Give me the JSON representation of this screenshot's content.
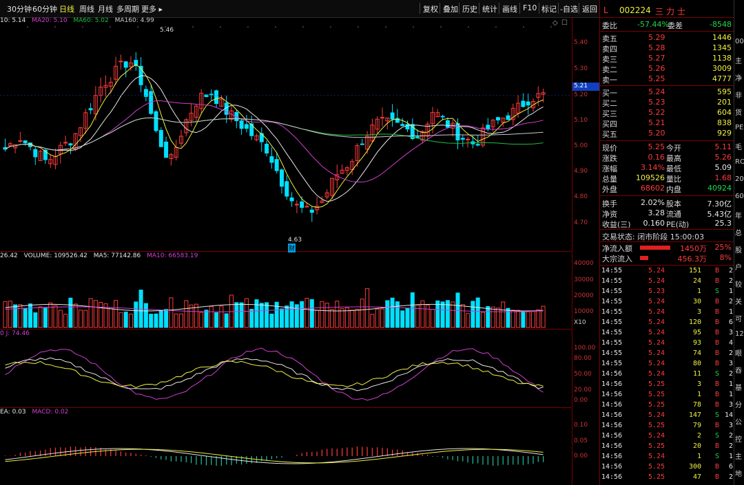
{
  "toolbar": {
    "periods": [
      "30分钟",
      "60分钟",
      "日线",
      "周线",
      "月线",
      "多周期",
      "更多 ▸"
    ],
    "active_period": "日线",
    "buttons": [
      "复权",
      "叠加",
      "历史",
      "统计",
      "画线",
      "F10",
      "标记",
      "-自选",
      "返回"
    ]
  },
  "main_chart": {
    "ma_legend": [
      {
        "text": "10: 5.14",
        "color": "#e8e8e8"
      },
      {
        "text": "MA20: 5.10",
        "color": "#d040d0"
      },
      {
        "text": "MA60: 5.02",
        "color": "#20c040"
      },
      {
        "text": "MA160: 4.99",
        "color": "#cccccc"
      }
    ],
    "high_label": "5.46",
    "low_label": "4.63",
    "low_marker": "财",
    "current_price_tag": "5.21",
    "ticks": [
      "5.40",
      "5.30",
      "5.20",
      "5.10",
      "5.00",
      "4.90",
      "4.80",
      "4.70"
    ]
  },
  "volume_chart": {
    "legend": [
      {
        "text": "26.42",
        "color": "#e8e8e8"
      },
      {
        "text": "VOLUME: 109526.42",
        "color": "#e8e8e8"
      },
      {
        "text": "MA5: 77142.86",
        "color": "#e8e8e8"
      },
      {
        "text": "MA10: 66583.19",
        "color": "#d040d0"
      }
    ],
    "ticks": [
      "40000",
      "30000",
      "20000",
      "10000"
    ],
    "unit": "X10"
  },
  "kdj_chart": {
    "legend": [
      {
        "text": "0  J: 74.46",
        "color": "#d040d0"
      }
    ],
    "ticks": [
      "100.00",
      "80.00",
      "50.00",
      "20.00",
      "0.00"
    ]
  },
  "macd_chart": {
    "legend": [
      {
        "text": "EA: 0.03",
        "color": "#e8e8e8"
      },
      {
        "text": "MACD: 0.02",
        "color": "#d040d0"
      }
    ],
    "ticks": [
      "0.10",
      "0.05",
      "0.00"
    ]
  },
  "quote": {
    "flag": "L",
    "code": "002224",
    "name": "三力士",
    "weibi_label": "委比",
    "weibi": "-57.44%",
    "weicha_label": "委差",
    "weicha": "-8548",
    "asks": [
      {
        "label": "卖五",
        "price": "5.29",
        "vol": "1446"
      },
      {
        "label": "卖四",
        "price": "5.28",
        "vol": "1345"
      },
      {
        "label": "卖三",
        "price": "5.27",
        "vol": "1138"
      },
      {
        "label": "卖二",
        "price": "5.26",
        "vol": "3009"
      },
      {
        "label": "卖一",
        "price": "5.25",
        "vol": "4777"
      }
    ],
    "bids": [
      {
        "label": "买一",
        "price": "5.24",
        "vol": "595"
      },
      {
        "label": "买二",
        "price": "5.23",
        "vol": "201"
      },
      {
        "label": "买三",
        "price": "5.22",
        "vol": "604"
      },
      {
        "label": "买四",
        "price": "5.21",
        "vol": "838"
      },
      {
        "label": "买五",
        "price": "5.20",
        "vol": "929"
      }
    ],
    "stats": [
      {
        "l1": "现价",
        "v1": "5.25",
        "c1": "red",
        "l2": "今开",
        "v2": "5.11",
        "c2": "red"
      },
      {
        "l1": "涨跌",
        "v1": "0.16",
        "c1": "red",
        "l2": "最高",
        "v2": "5.26",
        "c2": "red"
      },
      {
        "l1": "涨幅",
        "v1": "3.14%",
        "c1": "red",
        "l2": "最低",
        "v2": "5.09",
        "c2": "wht"
      },
      {
        "l1": "总量",
        "v1": "109526",
        "c1": "yel",
        "l2": "量比",
        "v2": "1.68",
        "c2": "red"
      },
      {
        "l1": "外盘",
        "v1": "68602",
        "c1": "red",
        "l2": "内盘",
        "v2": "40924",
        "c2": "grn"
      }
    ],
    "stats2": [
      {
        "l1": "换手",
        "v1": "2.02%",
        "l2": "股本",
        "v2": "7.30亿"
      },
      {
        "l1": "净资",
        "v1": "3.28",
        "l2": "流通",
        "v2": "5.43亿"
      },
      {
        "l1": "收益(三)",
        "v1": "0.160",
        "l2": "PE(动)",
        "v2": "25.3"
      }
    ],
    "trade_state": "交易状态: 闭市阶段 15:00:03",
    "flows": [
      {
        "label": "净流入额",
        "value": "1450万",
        "pct": "25%",
        "bar": 0.55
      },
      {
        "label": "大宗流入",
        "value": "456.3万",
        "pct": "8%",
        "bar": 0.15
      }
    ]
  },
  "ticks_list": [
    {
      "t": "14:55",
      "p": "5.24",
      "v": "151",
      "s": "B",
      "n": "2"
    },
    {
      "t": "14:55",
      "p": "5.24",
      "v": "24",
      "s": "B",
      "n": "2"
    },
    {
      "t": "14:55",
      "p": "5.23",
      "v": "1",
      "s": "S",
      "n": "1"
    },
    {
      "t": "14:55",
      "p": "5.24",
      "v": "30",
      "s": "B",
      "n": "2"
    },
    {
      "t": "14:55",
      "p": "5.24",
      "v": "3",
      "s": "B",
      "n": "1"
    },
    {
      "t": "14:55",
      "p": "5.24",
      "v": "120",
      "s": "B",
      "n": "6"
    },
    {
      "t": "14:55",
      "p": "5.24",
      "v": "95",
      "s": "B",
      "n": "3"
    },
    {
      "t": "14:55",
      "p": "5.24",
      "v": "93",
      "s": "B",
      "n": "4"
    },
    {
      "t": "14:55",
      "p": "5.24",
      "v": "74",
      "s": "B",
      "n": "2"
    },
    {
      "t": "14:55",
      "p": "5.24",
      "v": "80",
      "s": "B",
      "n": "3"
    },
    {
      "t": "14:56",
      "p": "5.24",
      "v": "11",
      "s": "S",
      "n": "2"
    },
    {
      "t": "14:56",
      "p": "5.25",
      "v": "3",
      "s": "B",
      "n": "1"
    },
    {
      "t": "14:56",
      "p": "5.25",
      "v": "1",
      "s": "B",
      "n": "1"
    },
    {
      "t": "14:56",
      "p": "5.25",
      "v": "78",
      "s": "B",
      "n": "3"
    },
    {
      "t": "14:56",
      "p": "5.24",
      "v": "147",
      "s": "S",
      "n": "14"
    },
    {
      "t": "14:56",
      "p": "5.25",
      "v": "79",
      "s": "B",
      "n": "3"
    },
    {
      "t": "14:56",
      "p": "5.24",
      "v": "2",
      "s": "S",
      "n": "2"
    },
    {
      "t": "14:56",
      "p": "5.25",
      "v": "20",
      "s": "B",
      "n": "2"
    },
    {
      "t": "14:56",
      "p": "5.24",
      "v": "1",
      "s": "S",
      "n": "1"
    },
    {
      "t": "14:56",
      "p": "5.25",
      "v": "300",
      "s": "B",
      "n": "6"
    },
    {
      "t": "14:56",
      "p": "5.25",
      "v": "47",
      "s": "B",
      "n": "2"
    }
  ],
  "far_right": [
    "00",
    "主",
    "净",
    "非",
    "货",
    "PE",
    "毛",
    "RO",
    "20",
    "60",
    "年",
    "总",
    "股",
    "户",
    "较",
    "关",
    "可",
    "12",
    "眼",
    "吞",
    "基",
    "分",
    "公",
    "控",
    "主",
    "地"
  ],
  "colors": {
    "up": "#ff3b3b",
    "down": "#00e0ff",
    "ma10": "#e8e8e8",
    "ma20": "#d040d0",
    "ma60": "#20c040",
    "ma160": "#cccccc",
    "yellow": "#f0f040",
    "border": "#7a0000"
  }
}
